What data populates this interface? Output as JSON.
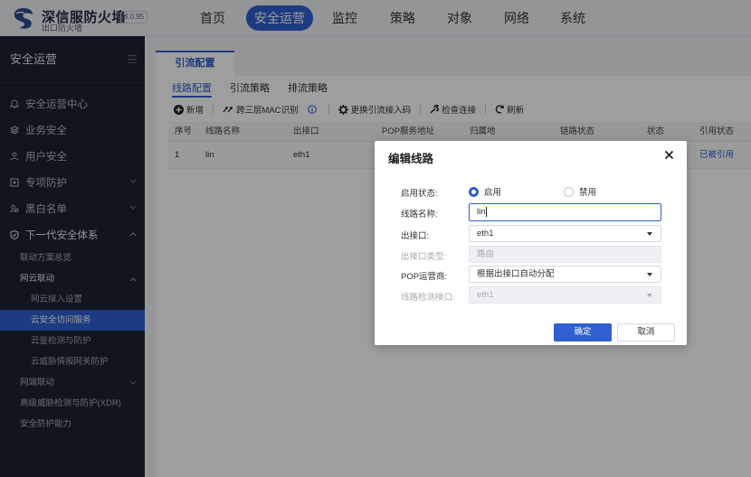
{
  "brand": {
    "name": "深信服防火墙",
    "sub": "出口防火墙",
    "version": "8.0.95"
  },
  "nav": [
    {
      "label": "首页"
    },
    {
      "label": "安全运营"
    },
    {
      "label": "监控"
    },
    {
      "label": "策略"
    },
    {
      "label": "对象"
    },
    {
      "label": "网络"
    },
    {
      "label": "系统"
    }
  ],
  "sidebar": {
    "title": "安全运营",
    "items": [
      {
        "label": "安全运营中心"
      },
      {
        "label": "业务安全"
      },
      {
        "label": "用户安全"
      },
      {
        "label": "专项防护"
      },
      {
        "label": "黑白名单"
      },
      {
        "label": "下一代安全体系"
      }
    ],
    "sub": {
      "linkage_overview": "联动方案总览",
      "net_cloud": "网云联动",
      "cloud_access": "网云接入设置",
      "cloud_security_service": "云安全访问服务",
      "cloud_detect": "云鉴检测与防护",
      "cloud_threat": "云威胁情报网关防护",
      "net_endpoint": "网端联动",
      "xdr": "高级威胁检测与防护(XDR)",
      "security_capability": "安全防护能力"
    }
  },
  "main": {
    "tab": "引流配置",
    "subtabs": [
      "线路配置",
      "引流策略",
      "排流策略"
    ],
    "toolbar": {
      "add": "新增",
      "mac": "跨三层MAC识别",
      "replace": "更换引流接入码",
      "check": "检查连接",
      "refresh": "刷新"
    },
    "table": {
      "headers": [
        "序号",
        "线路名称",
        "出接口",
        "POP服务地址",
        "归属地",
        "链路状态",
        "状态",
        "引用状态"
      ],
      "rows": [
        {
          "no": "1",
          "name": "lin",
          "iface": "eth1",
          "ref": "已被引用"
        }
      ]
    }
  },
  "modal": {
    "title": "编辑线路",
    "enable_label": "启用状态:",
    "enable_on": "启用",
    "enable_off": "禁用",
    "name_label": "线路名称:",
    "name_value": "lin",
    "iface_label": "出接口:",
    "iface_value": "eth1",
    "iface_type_label": "出接口类型:",
    "iface_type_value": "路由",
    "pop_label": "POP运营商:",
    "pop_value": "根据出接口自动分配",
    "detect_label": "线路检测接口:",
    "detect_value": "eth1",
    "ok": "确定",
    "cancel": "取消"
  },
  "colors": {
    "accent": "#2f5fd0",
    "sidebar_bg": "#1b2234"
  }
}
